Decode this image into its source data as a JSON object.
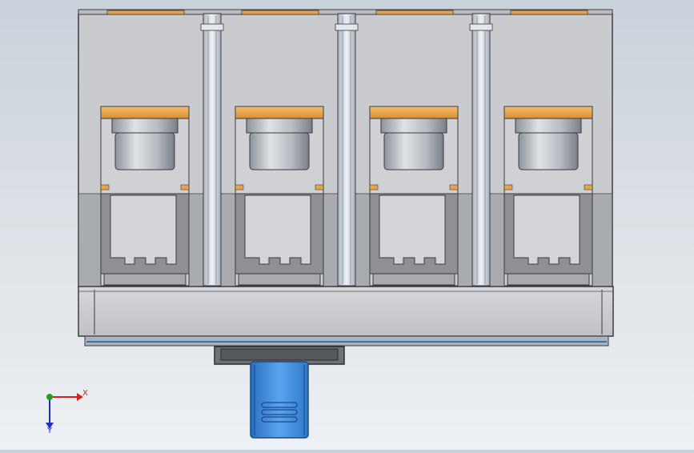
{
  "viewport": {
    "model": {
      "module_count": 4,
      "colors": {
        "housing": "#c6c8cc",
        "housing_edge": "#3a3c40",
        "housing_dark": "#8e9095",
        "cap": "#e8a24a",
        "cylinder": "#b7bbc2",
        "rail": "#d6dbe2",
        "blue_part": "#3f8ede",
        "base_strip": "#5c6f8a"
      }
    },
    "triad": {
      "x_label": "X",
      "y_label": "Y",
      "x_color": "#d42020",
      "y_color": "#2030c8",
      "origin_color": "#20a020"
    }
  }
}
